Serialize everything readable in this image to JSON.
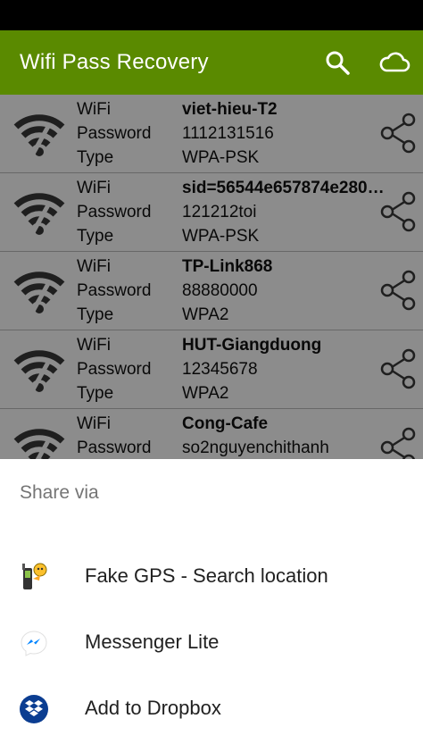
{
  "app": {
    "title": "Wifi Pass Recovery"
  },
  "labels": {
    "wifi": "WiFi",
    "password": "Password",
    "type": "Type"
  },
  "networks": [
    {
      "ssid": "viet-hieu-T2",
      "password": "1112131516",
      "type": "WPA-PSK"
    },
    {
      "ssid": "sid=56544e657874e280…",
      "password": "121212toi",
      "type": "WPA-PSK"
    },
    {
      "ssid": "TP-Link868",
      "password": "88880000",
      "type": "WPA2"
    },
    {
      "ssid": "HUT-Giangduong",
      "password": "12345678",
      "type": "WPA2"
    },
    {
      "ssid": "Cong-Cafe",
      "password": "so2nguyenchithanh",
      "type": ""
    }
  ],
  "share_sheet": {
    "title": "Share via",
    "items": [
      {
        "label": "Fake GPS - Search location",
        "icon": "fake-gps-icon"
      },
      {
        "label": "Messenger Lite",
        "icon": "messenger-lite-icon"
      },
      {
        "label": "Add to Dropbox",
        "icon": "dropbox-icon"
      }
    ]
  },
  "colors": {
    "app_bar": "#5a8a00",
    "scrim": "rgba(0,0,0,0.45)",
    "dropbox": "#0b3d91",
    "messenger": "#0084ff"
  }
}
